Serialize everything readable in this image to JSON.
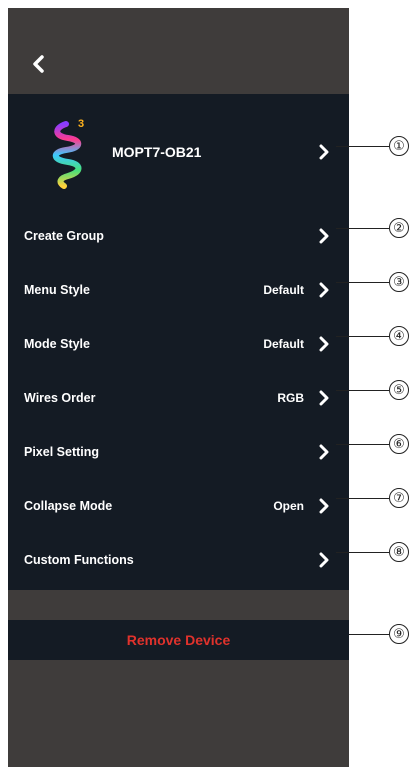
{
  "header": {
    "back_icon": "chevron-left-icon"
  },
  "device": {
    "name": "MOPT7-OB21",
    "logo_badge": "3",
    "logo_icon": "rainbow-spiral-logo"
  },
  "menu": {
    "items": [
      {
        "label": "Create Group",
        "value": ""
      },
      {
        "label": "Menu Style",
        "value": "Default"
      },
      {
        "label": "Mode Style",
        "value": "Default"
      },
      {
        "label": "Wires Order",
        "value": "RGB"
      },
      {
        "label": "Pixel Setting",
        "value": ""
      },
      {
        "label": "Collapse Mode",
        "value": "Open"
      },
      {
        "label": "Custom Functions",
        "value": ""
      }
    ]
  },
  "remove_device": {
    "label": "Remove Device"
  },
  "callouts": [
    "①",
    "②",
    "③",
    "④",
    "⑤",
    "⑥",
    "⑦",
    "⑧",
    "⑨"
  ],
  "colors": {
    "header_bg": "#3f3c3b",
    "panel_bg": "#141b24",
    "text": "#ffffff",
    "danger": "#e0322c"
  }
}
